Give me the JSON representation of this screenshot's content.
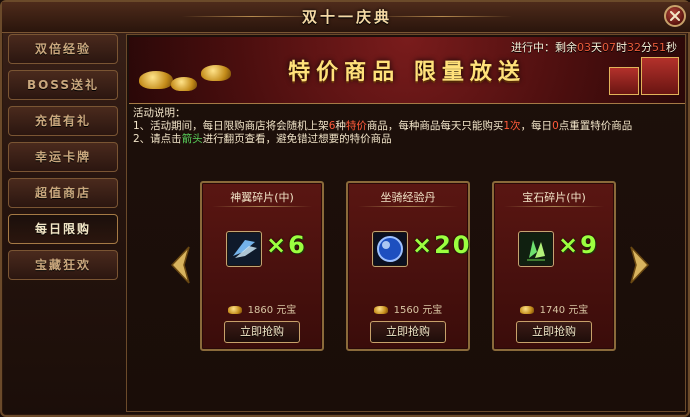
{
  "window": {
    "title": "双十一庆典"
  },
  "sidebar": {
    "tabs": [
      {
        "label": "双倍经验",
        "active": false
      },
      {
        "label": "BOSS送礼",
        "active": false
      },
      {
        "label": "充值有礼",
        "active": false
      },
      {
        "label": "幸运卡牌",
        "active": false
      },
      {
        "label": "超值商店",
        "active": false
      },
      {
        "label": "每日限购",
        "active": true
      },
      {
        "label": "宝藏狂欢",
        "active": false
      }
    ]
  },
  "banner": {
    "title": "特价商品 限量放送",
    "countdown": {
      "prefix": "进行中：剩余",
      "days": "03",
      "days_unit": "天",
      "hours": "07",
      "hours_unit": "时",
      "minutes": "32",
      "minutes_unit": "分",
      "seconds": "51",
      "seconds_unit": "秒"
    }
  },
  "description": {
    "heading": "活动说明：",
    "line1_a": "1、活动期间，每日限购商店将会随机上架",
    "line1_b": "6",
    "line1_c": "种",
    "line1_d": "特价",
    "line1_e": "商品，每种商品每天只能购买",
    "line1_f": "1次",
    "line1_g": "，每日",
    "line1_h": "0",
    "line1_i": "点重置特价商品",
    "line2_a": "2、请点击",
    "line2_b": "箭头",
    "line2_c": "进行翻页查看，避免错过想要的特价商品"
  },
  "items": [
    {
      "name": "神翼碎片(中)",
      "qty": "×6",
      "price": "1860",
      "currency": "元宝",
      "buy_label": "立即抢购",
      "icon": "wing-shard-icon"
    },
    {
      "name": "坐骑经验丹",
      "qty": "×20",
      "price": "1560",
      "currency": "元宝",
      "buy_label": "立即抢购",
      "icon": "mount-exp-pill-icon"
    },
    {
      "name": "宝石碎片(中)",
      "qty": "×9",
      "price": "1740",
      "currency": "元宝",
      "buy_label": "立即抢购",
      "icon": "gem-shard-icon"
    }
  ],
  "colors": {
    "accent_red": "#e85b3a",
    "qty_green": "#9cff3f",
    "gold": "#ffe17a"
  }
}
